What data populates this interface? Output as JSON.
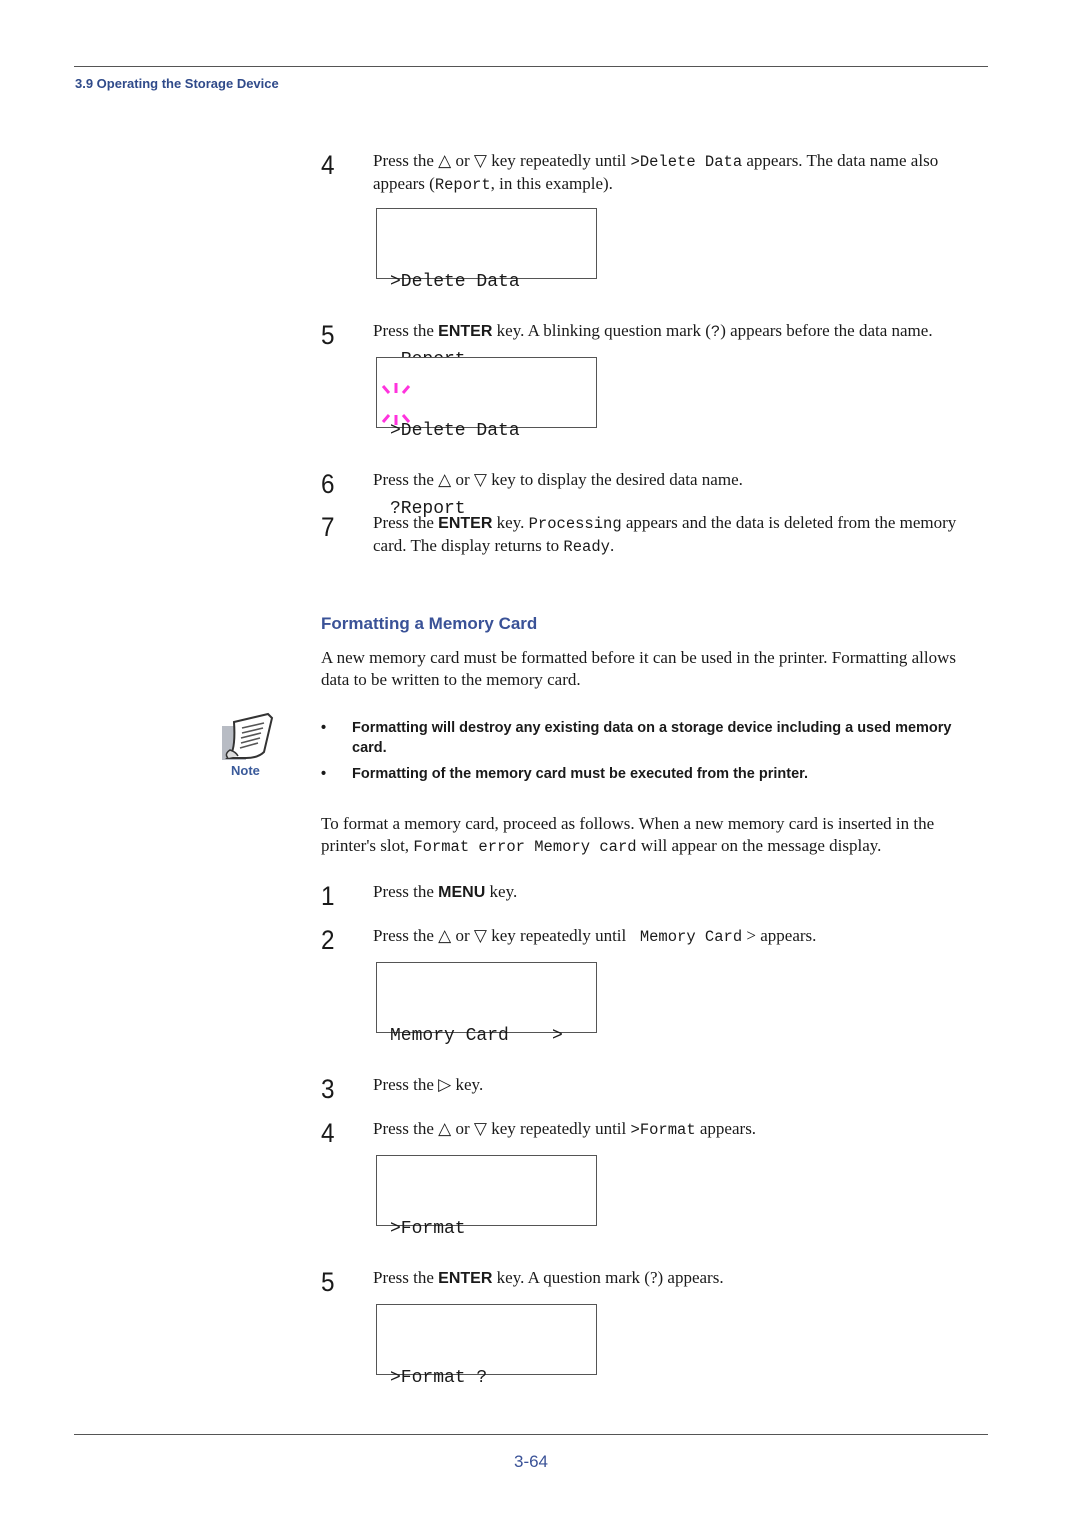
{
  "header": {
    "section_title": "3.9 Operating the Storage Device"
  },
  "delete_steps": [
    {
      "number": "4",
      "parts": [
        "Press the ",
        "△",
        " or ",
        "▽",
        " key repeatedly until ",
        ">Delete Data",
        " appears. The data name also appears (",
        "Report",
        ", in this example)."
      ],
      "display": {
        "line1": ">Delete Data",
        "line2": " Report"
      }
    },
    {
      "number": "5",
      "parts": [
        "Press the ",
        "ENTER",
        " key. A blinking question mark (",
        "?",
        ") appears before the data name."
      ],
      "display": {
        "line1": ">Delete Data",
        "line2": "?Report",
        "blinking_char": "?"
      }
    },
    {
      "number": "6",
      "parts": [
        "Press the ",
        "△",
        " or ",
        "▽",
        " key to display the desired data name."
      ]
    },
    {
      "number": "7",
      "parts": [
        "Press the ",
        "ENTER",
        " key. ",
        "Processing",
        " appears and the data is deleted from the memory card. The display returns to ",
        "Ready",
        "."
      ]
    }
  ],
  "formatting_section": {
    "heading": "Formatting a Memory Card",
    "intro": "A new memory card must be formatted before it can be used in the printer. Formatting allows data to be written to the memory card.",
    "note": {
      "label": "Note",
      "icon": "note-paper-icon",
      "items": [
        "Formatting will destroy any existing data on a storage device including a used memory card.",
        "Formatting of the memory card must be executed from the printer."
      ]
    },
    "procedure_intro_parts": [
      "To format a memory card, proceed as follows. When a new memory card is inserted in the printer's slot, ",
      "Format error Memory card",
      " will appear on the message display."
    ]
  },
  "format_steps": [
    {
      "number": "1",
      "parts": [
        "Press the ",
        "MENU",
        " key."
      ]
    },
    {
      "number": "2",
      "parts": [
        "Press the ",
        "△",
        " or ",
        "▽",
        " key repeatedly until ",
        " Memory Card",
        " > appears."
      ],
      "display": {
        "line1": "Memory Card    >",
        "line2": ""
      }
    },
    {
      "number": "3",
      "parts": [
        "Press the ",
        "▷",
        " key."
      ]
    },
    {
      "number": "4",
      "parts": [
        "Press the ",
        "△",
        " or ",
        "▽",
        " key repeatedly until ",
        ">Format",
        " appears."
      ],
      "display": {
        "line1": ">Format",
        "line2": ""
      }
    },
    {
      "number": "5",
      "parts": [
        "Press the ",
        "ENTER",
        " key. A question mark (?) appears."
      ],
      "display": {
        "line1": ">Format ?",
        "line2": ""
      }
    }
  ],
  "footer": {
    "page_number": "3-64"
  },
  "colors": {
    "heading_blue": "#3a5297",
    "blink_marks": "#ff33dd"
  }
}
